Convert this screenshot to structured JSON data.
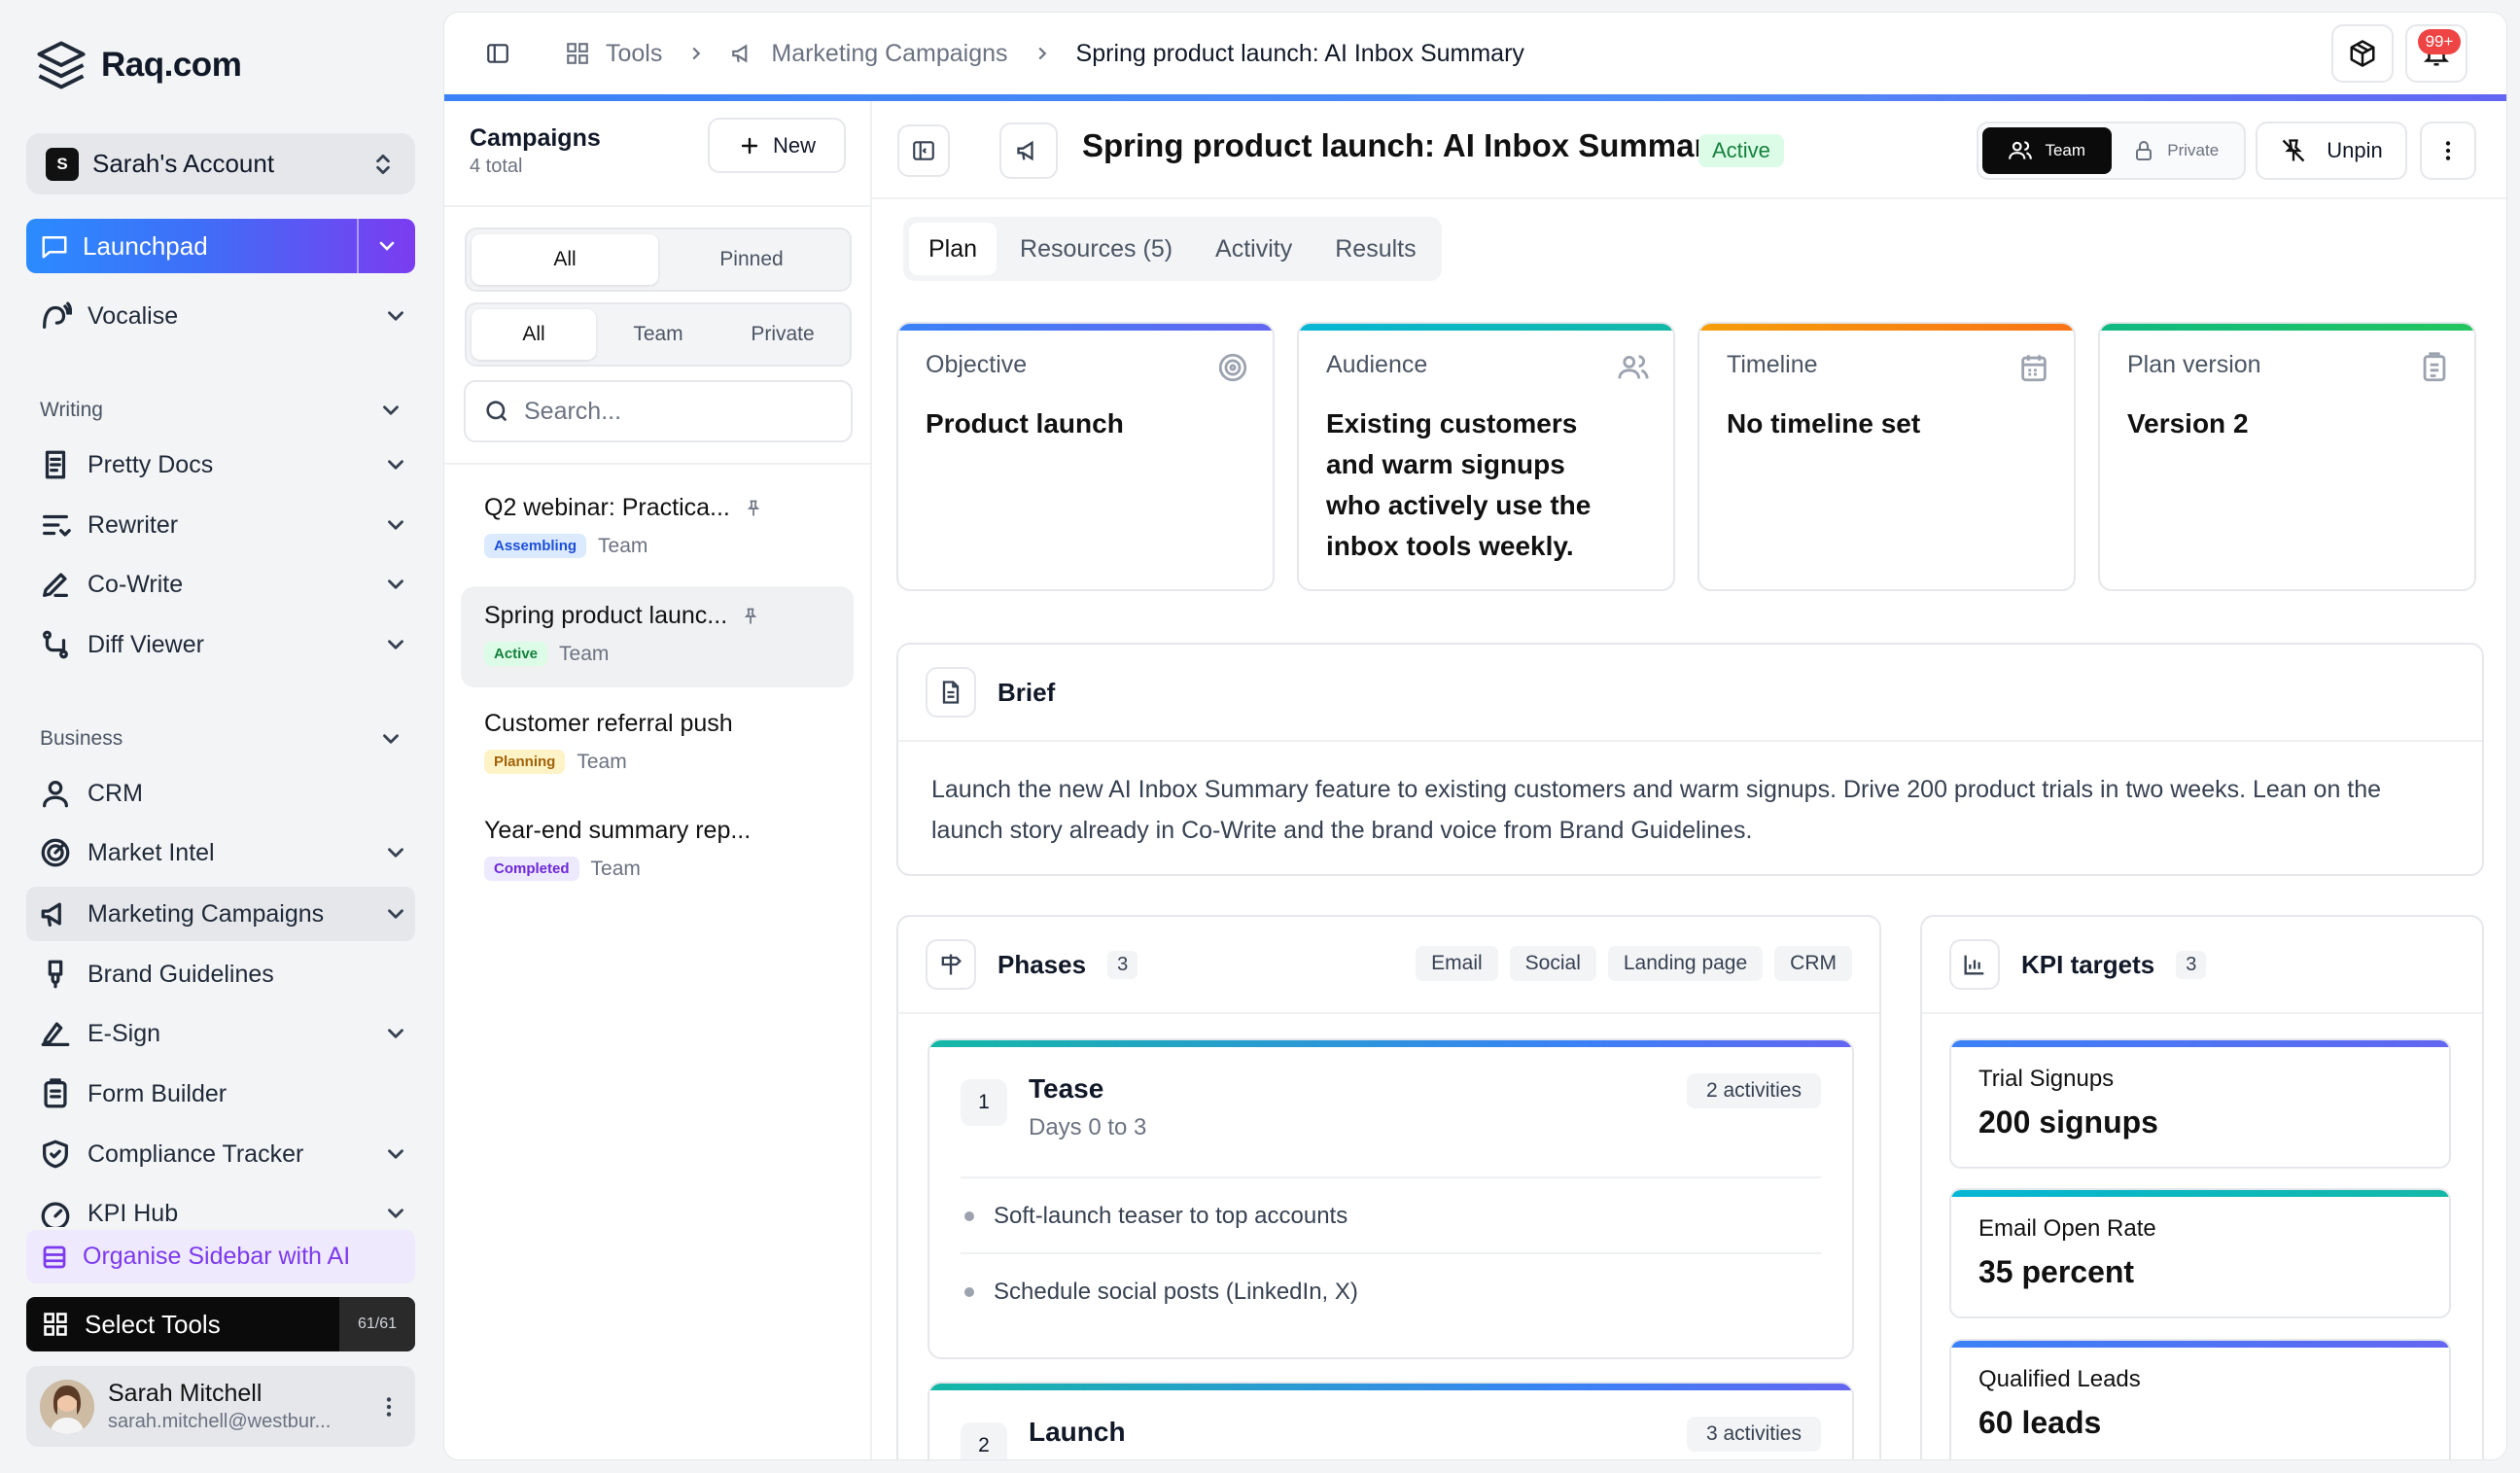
{
  "sidebar": {
    "logo_text": "Raq.com",
    "account_name": "Sarah's Account",
    "account_initial": "S",
    "launchpad_label": "Launchpad",
    "vocalise_label": "Vocalise",
    "writing_section": "Writing",
    "writing_items": [
      "Pretty Docs",
      "Rewriter",
      "Co-Write",
      "Diff Viewer"
    ],
    "business_section": "Business",
    "business_items": [
      "CRM",
      "Market Intel",
      "Marketing Campaigns",
      "Brand Guidelines",
      "E-Sign",
      "Form Builder",
      "Compliance Tracker",
      "KPI Hub"
    ],
    "organise_label": "Organise Sidebar with AI",
    "select_tools_label": "Select Tools",
    "select_tools_count": "61/61",
    "user_name": "Sarah Mitchell",
    "user_email": "sarah.mitchell@westbur..."
  },
  "breadcrumb": {
    "tools": "Tools",
    "section": "Marketing Campaigns",
    "current": "Spring product launch: AI Inbox Summary"
  },
  "notifications": {
    "count": "99+"
  },
  "campaigns": {
    "title": "Campaigns",
    "subtitle": "4 total",
    "new_label": "New",
    "filter1": [
      "All",
      "Pinned"
    ],
    "filter2": [
      "All",
      "Team",
      "Private"
    ],
    "search_placeholder": "Search...",
    "items": [
      {
        "title": "Q2 webinar: Practica...",
        "status": "Assembling",
        "scope": "Team"
      },
      {
        "title": "Spring product launc...",
        "status": "Active",
        "scope": "Team"
      },
      {
        "title": "Customer referral push",
        "status": "Planning",
        "scope": "Team"
      },
      {
        "title": "Year-end summary rep...",
        "status": "Completed",
        "scope": "Team"
      }
    ]
  },
  "detail": {
    "title": "Spring product launch: AI Inbox Summary",
    "status": "Active",
    "visibility": [
      "Team",
      "Private"
    ],
    "unpin_label": "Unpin",
    "tabs": [
      "Plan",
      "Resources (5)",
      "Activity",
      "Results"
    ],
    "cards": [
      {
        "label": "Objective",
        "value": "Product launch"
      },
      {
        "label": "Audience",
        "value": "Existing customers and warm signups who actively use the inbox tools weekly."
      },
      {
        "label": "Timeline",
        "value": "No timeline set"
      },
      {
        "label": "Plan version",
        "value": "Version 2"
      }
    ],
    "brief": {
      "title": "Brief",
      "text": "Launch the new AI Inbox Summary feature to existing customers and warm signups. Drive 200 product trials in two weeks. Lean on the launch story already in Co-Write and the brand voice from Brand Guidelines."
    },
    "phases": {
      "title": "Phases",
      "count": "3",
      "channels": [
        "Email",
        "Social",
        "Landing page",
        "CRM"
      ],
      "items": [
        {
          "num": "1",
          "name": "Tease",
          "days": "Days 0 to 3",
          "activities": "2 activities",
          "tasks": [
            "Soft-launch teaser to top accounts",
            "Schedule social posts (LinkedIn, X)"
          ]
        },
        {
          "num": "2",
          "name": "Launch",
          "activities": "3 activities"
        }
      ]
    },
    "kpis": {
      "title": "KPI targets",
      "count": "3",
      "items": [
        {
          "label": "Trial Signups",
          "value": "200 signups"
        },
        {
          "label": "Email Open Rate",
          "value": "35 percent"
        },
        {
          "label": "Qualified Leads",
          "value": "60 leads"
        }
      ]
    }
  },
  "colors": {
    "accent_blue": "#3b82f6",
    "active_green": "#15803d",
    "organise_purple": "#7c3aed",
    "notif_red": "#ef4444"
  }
}
